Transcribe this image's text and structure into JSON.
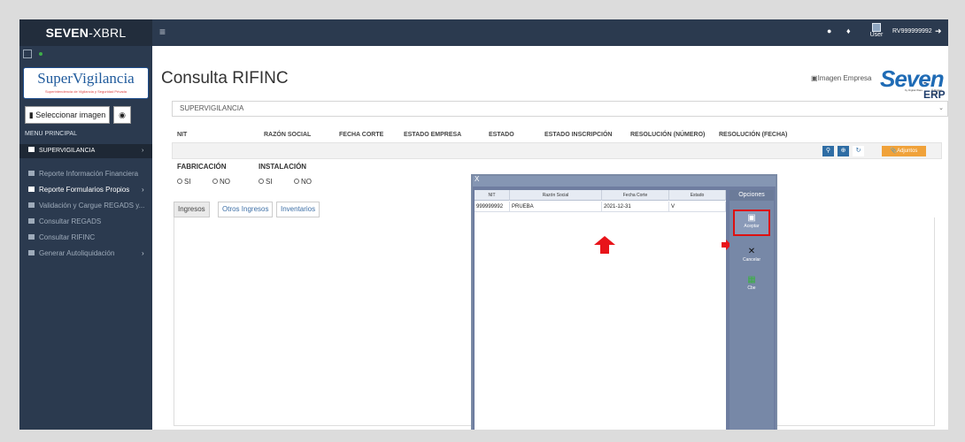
{
  "header": {
    "brand_bold": "SEVEN",
    "brand_rest": "-XBRL",
    "menu_icon": "≡",
    "user_label": "User",
    "user_id": "RV999999992"
  },
  "sidebar": {
    "logo_text": "SuperVigilancia",
    "logo_subtitle": "Superintendencia de Vigilancia y Seguridad Privada",
    "image_button": "Seleccionar imagen",
    "menu_title": "MENU PRINCIPAL",
    "items": [
      {
        "label": "SUPERVIGILANCIA",
        "has_arrow": true
      },
      {
        "label": "Reporte Información Financiera",
        "has_arrow": true
      },
      {
        "label": "Reporte Formularios Propios",
        "has_arrow": true
      },
      {
        "label": "Validación y Cargue REGADS y...",
        "has_arrow": false
      },
      {
        "label": "Consultar REGADS",
        "has_arrow": false
      },
      {
        "label": "Consultar RIFINC",
        "has_arrow": false
      },
      {
        "label": "Generar Autoliquidación",
        "has_arrow": true
      }
    ]
  },
  "main": {
    "title": "Consulta RIFINC",
    "imagen_empresa_alt": "Imagen Empresa",
    "seven_logo": {
      "big": "Seven",
      "erp": "-ERP",
      "by": "by Digital Ware",
      "sub": "® Digital Ware"
    },
    "company_select": "SUPERVIGILANCIA",
    "columns": [
      "NIT",
      "RAZÓN SOCIAL",
      "FECHA CORTE",
      "ESTADO EMPRESA",
      "ESTADO",
      "ESTADO INSCRIPCIÓN",
      "RESOLUCIÓN (NÚMERO)",
      "RESOLUCIÓN (FECHA)"
    ],
    "adjuntos_label": "Adjuntos",
    "fabricacion_label": "FABRICACIÓN",
    "instalacion_label": "INSTALACIÓN",
    "si": "SI",
    "no": "NO",
    "tabs": [
      "Ingresos",
      "Otros Ingresos",
      "Inventarios"
    ]
  },
  "modal": {
    "close": "X",
    "grid_headers": [
      "NIT",
      "Razón Social",
      "Fecha Corte",
      "Estado"
    ],
    "row": {
      "nit": "999999992",
      "razon": "PRUEBA",
      "fecha": "2021-12-31",
      "estado": "V"
    },
    "options_title": "Opciones",
    "aceptar": "Aceptar",
    "cancelar": "Cancelar",
    "cbe": "Cbe"
  },
  "colors": {
    "topbar": "#2b3a4f",
    "accent_blue": "#2e6da4",
    "adjuntos_orange": "#f0a23a",
    "highlight_red": "#e8141a"
  }
}
